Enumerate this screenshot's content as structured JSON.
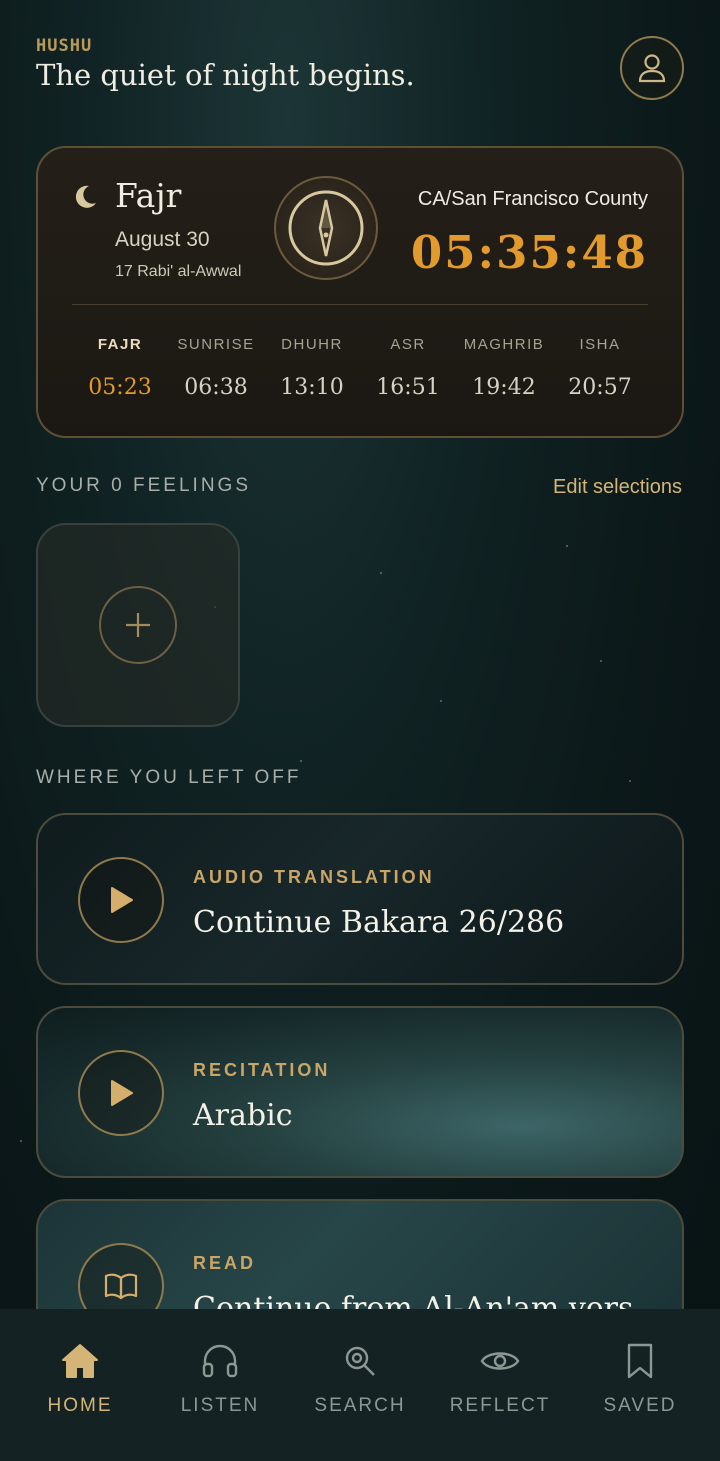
{
  "header": {
    "brand": "HUSHU",
    "tagline": "The quiet of night begins."
  },
  "prayer_card": {
    "current_prayer": "Fajr",
    "gregorian_date": "August 30",
    "hijri_date": "17 Rabi' al-Awwal",
    "location": "CA/San Francisco County",
    "countdown": "05:35:48",
    "times": [
      {
        "label": "FAJR",
        "time": "05:23",
        "active": true
      },
      {
        "label": "SUNRISE",
        "time": "06:38"
      },
      {
        "label": "DHUHR",
        "time": "13:10"
      },
      {
        "label": "ASR",
        "time": "16:51"
      },
      {
        "label": "MAGHRIB",
        "time": "19:42"
      },
      {
        "label": "ISHA",
        "time": "20:57"
      }
    ]
  },
  "feelings": {
    "title": "YOUR 0 FEELINGS",
    "edit_label": "Edit selections"
  },
  "resume": {
    "title": "WHERE YOU LEFT OFF",
    "cards": [
      {
        "kicker": "AUDIO TRANSLATION",
        "title": "Continue Bakara 26/286",
        "icon": "play-icon"
      },
      {
        "kicker": "RECITATION",
        "title": "Arabic",
        "icon": "play-icon"
      },
      {
        "kicker": "READ",
        "title": "Continue from Al-An'am vers",
        "icon": "book-icon"
      }
    ]
  },
  "nav": {
    "items": [
      {
        "label": "HOME",
        "icon": "home-icon",
        "active": true
      },
      {
        "label": "LISTEN",
        "icon": "headphones-icon"
      },
      {
        "label": "SEARCH",
        "icon": "search-icon"
      },
      {
        "label": "REFLECT",
        "icon": "eye-icon"
      },
      {
        "label": "SAVED",
        "icon": "bookmark-icon"
      }
    ]
  },
  "colors": {
    "accent_gold": "#d4b577",
    "countdown_orange": "#e39a2c",
    "background": "#0b1718"
  }
}
